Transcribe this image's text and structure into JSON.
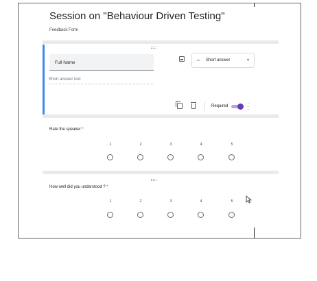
{
  "form": {
    "title": "Session on \"Behaviour Driven Testing\"",
    "description": "Feedback Form"
  },
  "editing_question": {
    "title": "Full Name",
    "type_label": "Short answer",
    "answer_placeholder": "Short answer text",
    "required_label": "Required",
    "required": true
  },
  "scale_questions": [
    {
      "label": "Rate the speaker",
      "required_mark": "*",
      "scale": [
        "1",
        "2",
        "3",
        "4",
        "5"
      ]
    },
    {
      "label": "How well did you understood ?",
      "required_mark": "*",
      "scale": [
        "1",
        "2",
        "3",
        "4",
        "5"
      ]
    }
  ],
  "icons": {
    "drag": "drag-handle-icon",
    "image": "image-icon",
    "short_answer": "short-text-icon",
    "dropdown": "chevron-down-icon",
    "duplicate": "copy-icon",
    "delete": "trash-icon",
    "more": "more-vert-icon",
    "cursor": "mouse-pointer-icon"
  },
  "colors": {
    "accent": "#4285f4",
    "toggle": "#673ab7",
    "required": "#d93025",
    "divider": "#e8eaed"
  }
}
